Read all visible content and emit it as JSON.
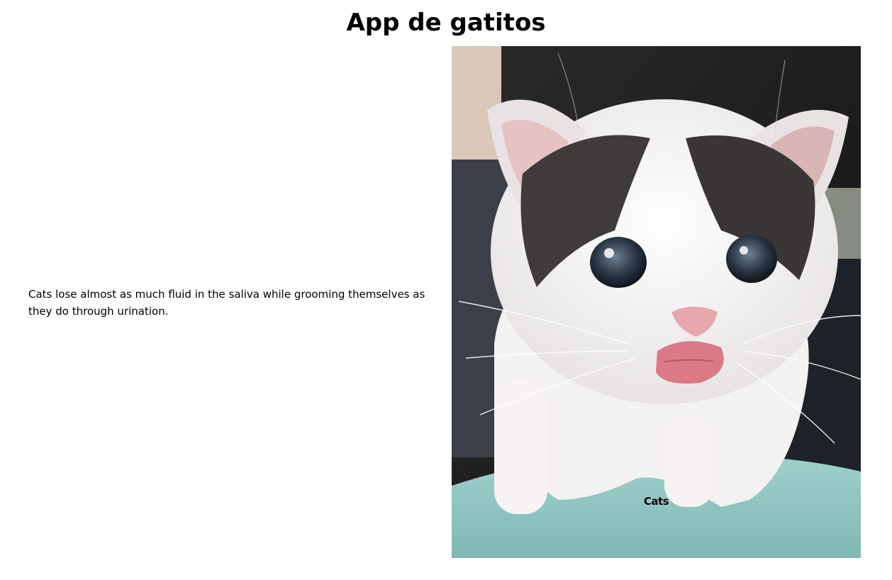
{
  "page": {
    "title": "App de gatitos"
  },
  "fact": {
    "text": "Cats lose almost as much fluid in the saliva while grooming themselves as they do through urination."
  },
  "image": {
    "caption": "Cats",
    "subject": "kitten"
  }
}
